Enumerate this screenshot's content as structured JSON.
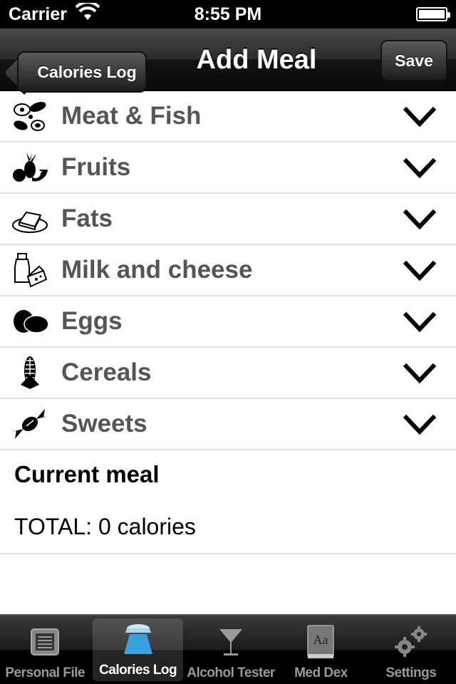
{
  "status_bar": {
    "carrier": "Carrier",
    "time": "8:55 PM"
  },
  "nav": {
    "back_label": "Calories Log",
    "title": "Add Meal",
    "save_label": "Save"
  },
  "categories": [
    {
      "label": "Meat & Fish",
      "icon": "meat-fish-icon"
    },
    {
      "label": "Fruits",
      "icon": "fruits-icon"
    },
    {
      "label": "Fats",
      "icon": "fats-icon"
    },
    {
      "label": "Milk and cheese",
      "icon": "milk-cheese-icon"
    },
    {
      "label": "Eggs",
      "icon": "eggs-icon"
    },
    {
      "label": "Cereals",
      "icon": "cereals-icon"
    },
    {
      "label": "Sweets",
      "icon": "sweets-icon"
    }
  ],
  "current_meal": {
    "title": "Current meal",
    "total": "TOTAL: 0 calories"
  },
  "tabs": [
    {
      "label": "Personal File",
      "icon": "personal-file-icon",
      "active": false
    },
    {
      "label": "Calories Log",
      "icon": "scale-icon",
      "active": true
    },
    {
      "label": "Alcohol Tester",
      "icon": "cocktail-icon",
      "active": false
    },
    {
      "label": "Med Dex",
      "icon": "book-icon",
      "active": false
    },
    {
      "label": "Settings",
      "icon": "gears-icon",
      "active": false
    }
  ],
  "colors": {
    "active_tab_icon": "#3aa0e0",
    "category_text": "#555555"
  }
}
